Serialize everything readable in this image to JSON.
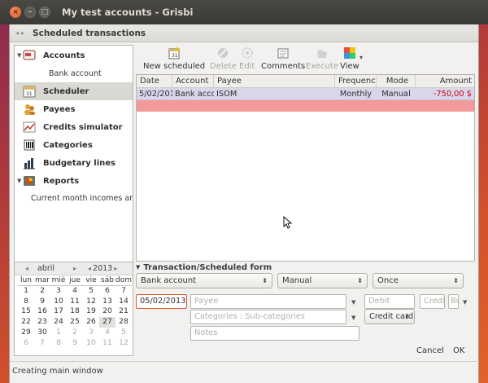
{
  "window": {
    "title": "My test accounts - Grisbi",
    "close_glyph": "×",
    "min_glyph": "–",
    "max_glyph": "□"
  },
  "header": {
    "back_glyph": "◂",
    "forward_glyph": "▸",
    "title": "Scheduled transactions"
  },
  "sidebar": {
    "items": [
      {
        "label": "Accounts",
        "icon": "accounts-icon",
        "expander": "▼"
      },
      {
        "label": "Bank account"
      },
      {
        "label": "Scheduler",
        "icon": "scheduler-icon"
      },
      {
        "label": "Payees",
        "icon": "payees-icon"
      },
      {
        "label": "Credits simulator",
        "icon": "credits-simulator-icon"
      },
      {
        "label": "Categories",
        "icon": "categories-icon"
      },
      {
        "label": "Budgetary lines",
        "icon": "budgetary-lines-icon"
      },
      {
        "label": "Reports",
        "icon": "reports-icon",
        "expander": "▼"
      },
      {
        "label": "Current month incomes and o"
      }
    ]
  },
  "calendar": {
    "month": "abril",
    "year": "2013",
    "prev_glyph": "◂",
    "next_glyph": "▸",
    "days_of_week": [
      "lun",
      "mar",
      "mié",
      "jue",
      "vie",
      "sáb",
      "dom"
    ],
    "weeks": [
      [
        "1",
        "2",
        "3",
        "4",
        "5",
        "6",
        "7"
      ],
      [
        "8",
        "9",
        "10",
        "11",
        "12",
        "13",
        "14"
      ],
      [
        "15",
        "16",
        "17",
        "18",
        "19",
        "20",
        "21"
      ],
      [
        "22",
        "23",
        "24",
        "25",
        "26",
        "27",
        "28"
      ],
      [
        "29",
        "30",
        "1",
        "2",
        "3",
        "4",
        "5"
      ],
      [
        "6",
        "7",
        "8",
        "9",
        "10",
        "11",
        "12"
      ]
    ],
    "today": "27"
  },
  "toolbar": {
    "new_scheduled": "New scheduled",
    "delete": "Delete",
    "edit": "Edit",
    "comments": "Comments",
    "execute": "Execute",
    "view": "View",
    "view_dropdown_glyph": "▾"
  },
  "table": {
    "columns": [
      "Date",
      "Account",
      "Payee",
      "Frequency",
      "Mode",
      "Amount"
    ],
    "rows": [
      {
        "date": "5/02/201",
        "account": "Bank accou",
        "payee": "ISOM",
        "frequency": "Monthly",
        "mode": "Manual",
        "amount": "-750,00 $"
      }
    ],
    "amount_negative_color": "#d0001c",
    "scheduled_row_color": "#d8d7ea",
    "total_row_color": "#f29a9a"
  },
  "form": {
    "header": "Transaction/Scheduled form",
    "expander": "▼",
    "account_combo": "Bank account",
    "mode_combo": "Manual",
    "frequency_combo": "Once",
    "date_value": "05/02/2013",
    "payee_placeholder": "Payee",
    "debit_placeholder": "Debit",
    "credit_placeholder": "Credit",
    "bu_placeholder": "Bu",
    "categories_placeholder": "Categories : Sub-categories",
    "payment_method": "Credit card",
    "notes_placeholder": "Notes",
    "cancel": "Cancel",
    "ok": "OK"
  },
  "statusbar": {
    "text": "Creating main window"
  }
}
